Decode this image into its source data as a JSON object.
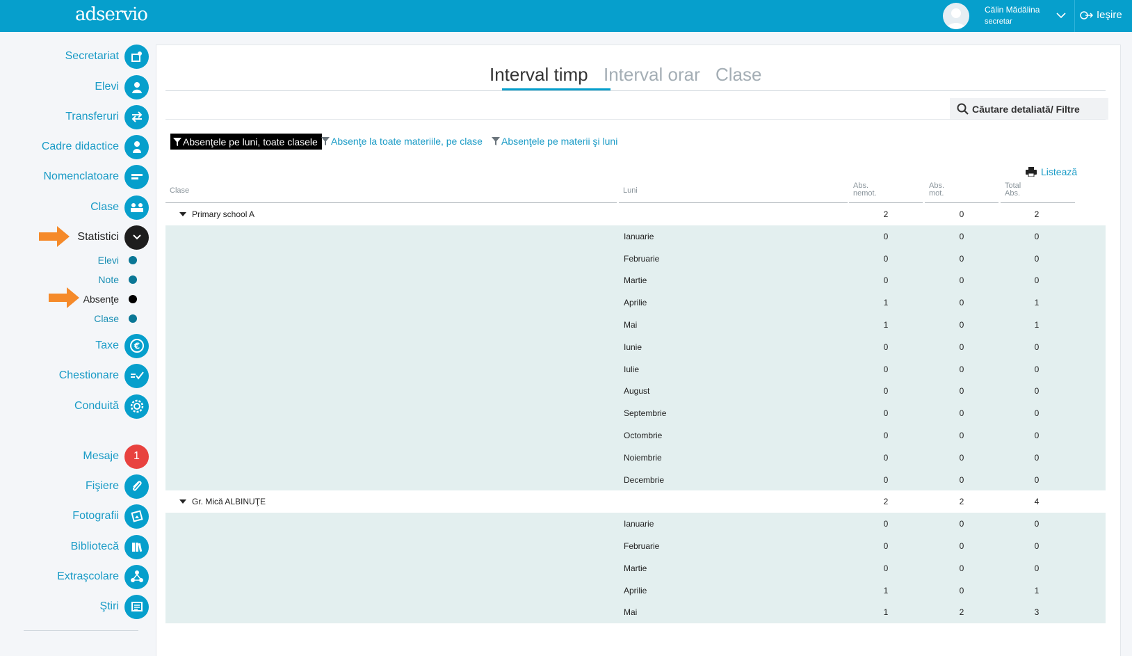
{
  "header": {
    "logo": "adservio",
    "user_name": "Călin Mădălina",
    "user_role": "secretar",
    "logout_label": "Ieşire",
    "accent_color": "#069fcc"
  },
  "sidebar": {
    "items": [
      {
        "label": "Secretariat",
        "icon": "secretariat-icon"
      },
      {
        "label": "Elevi",
        "icon": "student-icon"
      },
      {
        "label": "Transferuri",
        "icon": "transfer-arrows-icon"
      },
      {
        "label": "Cadre didactice",
        "icon": "teacher-icon"
      },
      {
        "label": "Nomenclatoare",
        "icon": "list-icon"
      },
      {
        "label": "Clase",
        "icon": "class-group-icon"
      },
      {
        "label": "Statistici",
        "icon": "chevron-down-icon",
        "active": true
      },
      {
        "label": "Taxe",
        "icon": "euro-icon"
      },
      {
        "label": "Chestionare",
        "icon": "questionnaire-check-icon"
      },
      {
        "label": "Conduită",
        "icon": "conduct-badge-icon"
      },
      {
        "label": "Mesaje",
        "icon": "messages-badge",
        "badge": "1"
      },
      {
        "label": "Fişiere",
        "icon": "paperclip-icon"
      },
      {
        "label": "Fotografii",
        "icon": "photos-icon"
      },
      {
        "label": "Bibliotecă",
        "icon": "books-icon"
      },
      {
        "label": "Extraşcolare",
        "icon": "activities-icon"
      },
      {
        "label": "Ştiri",
        "icon": "news-icon"
      }
    ],
    "statistici_sub": [
      {
        "label": "Elevi"
      },
      {
        "label": "Note"
      },
      {
        "label": "Absenţe",
        "active": true
      },
      {
        "label": "Clase"
      }
    ]
  },
  "tabs": [
    {
      "label": "Interval timp",
      "active": true
    },
    {
      "label": "Interval orar"
    },
    {
      "label": "Clase"
    }
  ],
  "search_label": "Căutare detaliată/ Filtre",
  "filters": [
    {
      "label": "Absenţele pe luni, toate clasele",
      "active": true
    },
    {
      "label": "Absenţe la toate materiile, pe clase"
    },
    {
      "label": "Absenţele pe materii şi luni"
    }
  ],
  "print_label": "Listează",
  "table": {
    "headers": {
      "clase": "Clase",
      "luni": "Luni",
      "abs_nemot_1": "Abs.",
      "abs_nemot_2": "nemot.",
      "abs_mot_1": "Abs.",
      "abs_mot_2": "mot.",
      "total_1": "Total",
      "total_2": "Abs."
    },
    "groups": [
      {
        "name": "Primary school A",
        "nemot": "2",
        "mot": "0",
        "total": "2",
        "months": [
          {
            "m": "Ianuarie",
            "n": "0",
            "mo": "0",
            "t": "0"
          },
          {
            "m": "Februarie",
            "n": "0",
            "mo": "0",
            "t": "0"
          },
          {
            "m": "Martie",
            "n": "0",
            "mo": "0",
            "t": "0"
          },
          {
            "m": "Aprilie",
            "n": "1",
            "mo": "0",
            "t": "1"
          },
          {
            "m": "Mai",
            "n": "1",
            "mo": "0",
            "t": "1"
          },
          {
            "m": "Iunie",
            "n": "0",
            "mo": "0",
            "t": "0"
          },
          {
            "m": "Iulie",
            "n": "0",
            "mo": "0",
            "t": "0"
          },
          {
            "m": "August",
            "n": "0",
            "mo": "0",
            "t": "0"
          },
          {
            "m": "Septembrie",
            "n": "0",
            "mo": "0",
            "t": "0"
          },
          {
            "m": "Octombrie",
            "n": "0",
            "mo": "0",
            "t": "0"
          },
          {
            "m": "Noiembrie",
            "n": "0",
            "mo": "0",
            "t": "0"
          },
          {
            "m": "Decembrie",
            "n": "0",
            "mo": "0",
            "t": "0"
          }
        ]
      },
      {
        "name": "Gr. Mică ALBINUŢE",
        "nemot": "2",
        "mot": "2",
        "total": "4",
        "months": [
          {
            "m": "Ianuarie",
            "n": "0",
            "mo": "0",
            "t": "0"
          },
          {
            "m": "Februarie",
            "n": "0",
            "mo": "0",
            "t": "0"
          },
          {
            "m": "Martie",
            "n": "0",
            "mo": "0",
            "t": "0"
          },
          {
            "m": "Aprilie",
            "n": "1",
            "mo": "0",
            "t": "1"
          },
          {
            "m": "Mai",
            "n": "1",
            "mo": "2",
            "t": "3"
          }
        ]
      }
    ]
  }
}
